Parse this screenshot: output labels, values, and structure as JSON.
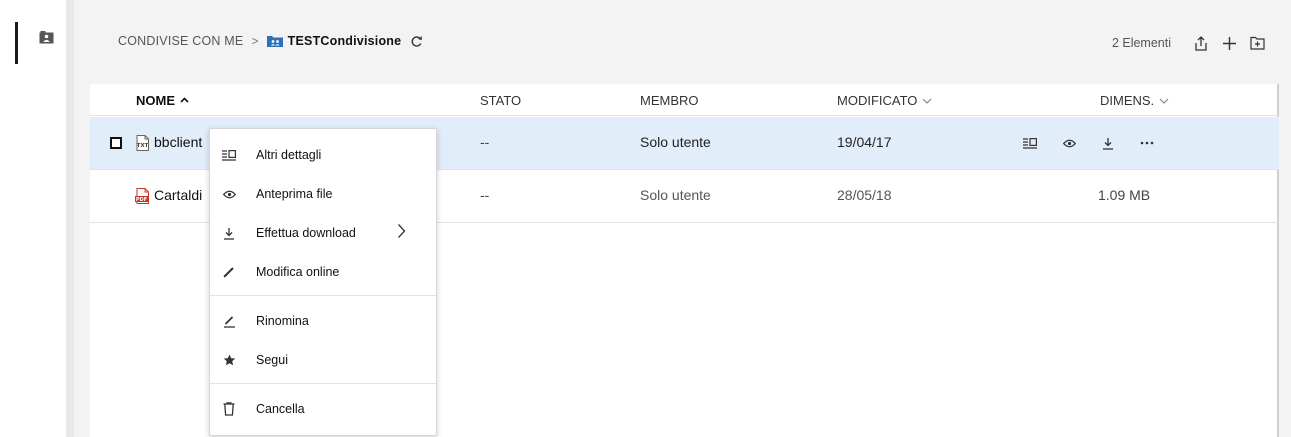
{
  "breadcrumb": {
    "root": "CONDIVISE CON ME",
    "separator": ">",
    "folder": "TESTCondivisione"
  },
  "toolbar": {
    "count": "2 Elementi"
  },
  "table": {
    "columns": {
      "name": "NOME",
      "name_sort": "^",
      "status": "STATO",
      "member": "MEMBRO",
      "modified": "MODIFICATO",
      "size": "DIMENS."
    },
    "rows": [
      {
        "name": "bbclient",
        "status": "--",
        "member": "Solo utente",
        "modified": "19/04/17",
        "size": "",
        "type": "txt",
        "selected": true
      },
      {
        "name": "Cartaldi",
        "status": "--",
        "member": "Solo utente",
        "modified": "28/05/18",
        "size": "1.09 MB",
        "type": "pdf",
        "selected": false
      }
    ]
  },
  "context_menu": {
    "items": [
      {
        "label": "Altri dettagli",
        "icon": "details-icon"
      },
      {
        "label": "Anteprima file",
        "icon": "eye-icon"
      },
      {
        "label": "Effettua download",
        "icon": "download-icon",
        "submenu": ">"
      },
      {
        "label": "Modifica online",
        "icon": "pencil-icon"
      },
      {
        "label": "Rinomina",
        "icon": "rename-icon"
      },
      {
        "label": "Segui",
        "icon": "star-icon"
      },
      {
        "label": "Cancella",
        "icon": "trash-icon"
      }
    ]
  },
  "icons": {
    "rail": "shared-folder-icon",
    "refresh": "refresh-icon",
    "upload": "upload-icon",
    "add": "plus-icon",
    "new_folder": "new-folder-icon",
    "txt_file": "txt-file-icon",
    "pdf_file": "pdf-file-icon",
    "more": "ellipsis-icon"
  },
  "colors": {
    "selected_row": "#e1edf9",
    "accent_folder": "#2f6fb5",
    "pdf_red": "#c8352b"
  }
}
